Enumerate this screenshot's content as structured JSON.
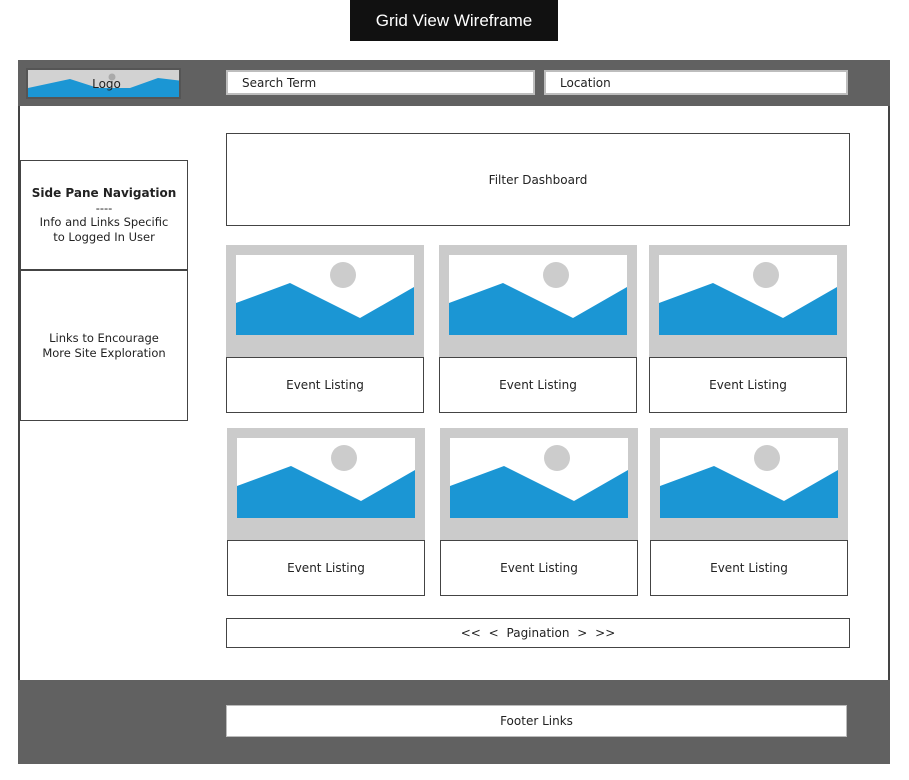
{
  "page_title": "Grid View Wireframe",
  "header": {
    "logo_label": "Logo",
    "search_placeholder": "Search Term",
    "location_placeholder": "Location"
  },
  "sidebar": {
    "nav_title": "Side Pane Navigation",
    "nav_separator": "----",
    "nav_desc_line1": "Info and Links Specific",
    "nav_desc_line2": "to Logged In User",
    "explore_line1": "Links to Encourage",
    "explore_line2": "More Site Exploration"
  },
  "main": {
    "filter_label": "Filter Dashboard",
    "listings": [
      {
        "label": "Event Listing"
      },
      {
        "label": "Event Listing"
      },
      {
        "label": "Event Listing"
      },
      {
        "label": "Event Listing"
      },
      {
        "label": "Event Listing"
      },
      {
        "label": "Event Listing"
      }
    ],
    "pagination_label": "<< < Pagination > >>"
  },
  "footer": {
    "links_label": "Footer Links"
  },
  "colors": {
    "header_bg": "#616161",
    "placeholder_gray": "#cbcbcb",
    "mountain_blue": "#1b96d4",
    "sun_gray": "#cccccc"
  }
}
